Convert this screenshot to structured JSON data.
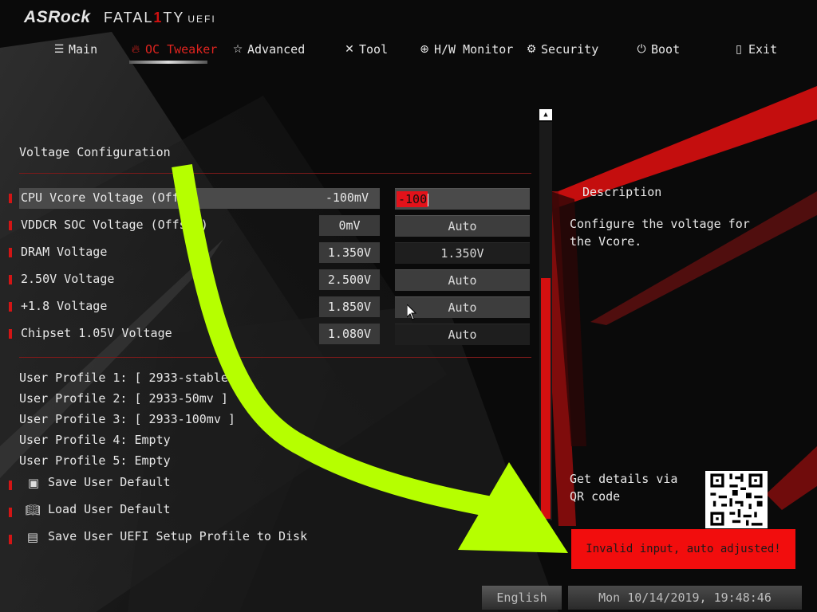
{
  "header": {
    "brand": "ASRock",
    "product_prefix": "FATAL",
    "product_one": "1",
    "product_suffix": "TY",
    "uefi": "UEFI"
  },
  "nav": [
    {
      "label": "Main",
      "icon": "list-icon",
      "active": false
    },
    {
      "label": "OC Tweaker",
      "icon": "flame-icon",
      "active": true
    },
    {
      "label": "Advanced",
      "icon": "star-icon",
      "active": false
    },
    {
      "label": "Tool",
      "icon": "tools-icon",
      "active": false
    },
    {
      "label": "H/W Monitor",
      "icon": "monitor-crosshair-icon",
      "active": false
    },
    {
      "label": "Security",
      "icon": "shield-gear-icon",
      "active": false
    },
    {
      "label": "Boot",
      "icon": "power-icon",
      "active": false
    },
    {
      "label": "Exit",
      "icon": "exit-door-icon",
      "active": false
    }
  ],
  "section_title": "Voltage Configuration",
  "voltages": [
    {
      "label": "CPU Vcore Voltage (Offset)",
      "value": "-100mV",
      "input": "-100",
      "highlighted": true
    },
    {
      "label": "VDDCR SOC Voltage (Offset)",
      "value": "0mV",
      "input": "Auto"
    },
    {
      "label": "DRAM Voltage",
      "value": "1.350V",
      "input": "1.350V"
    },
    {
      "label": "2.50V Voltage",
      "value": "2.500V",
      "input": "Auto"
    },
    {
      "label": "+1.8 Voltage",
      "value": "1.850V",
      "input": "Auto"
    },
    {
      "label": "Chipset 1.05V Voltage",
      "value": "1.080V",
      "input": "Auto"
    }
  ],
  "profiles": [
    "User Profile 1: [ 2933-stable ]",
    "User Profile 2: [ 2933-50mv ]",
    "User Profile 3: [ 2933-100mv ]",
    "User Profile 4: Empty",
    "User Profile 5: Empty"
  ],
  "actions": [
    {
      "label": "Save User Default",
      "icon": "floppy-disk-icon"
    },
    {
      "label": "Load User Default",
      "icon": "open-book-icon"
    },
    {
      "label": "Save User UEFI Setup Profile to Disk",
      "icon": "floppy-stack-icon"
    }
  ],
  "description": {
    "title": "Description",
    "text": "Configure the voltage for the Vcore.",
    "qr_label": "Get details via QR code"
  },
  "toast": "Invalid input, auto adjusted!",
  "footer": {
    "language": "English",
    "datetime": "Mon 10/14/2019, 19:48:46"
  },
  "colors": {
    "accent": "#e0241f",
    "toast_bg": "#f20d0d",
    "arrow": "#b6ff00",
    "scroll_thumb": "#d41010"
  }
}
